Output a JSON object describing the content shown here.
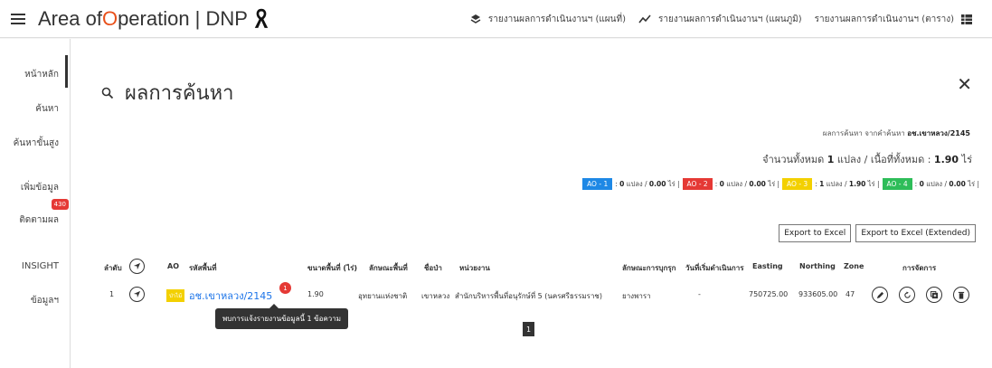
{
  "app": {
    "title_prefix": "Area of ",
    "title_o": "O",
    "title_suffix": "peration | DNP",
    "menu_icon": "hamburger-menu-icon",
    "ribbon_icon": "mourning-ribbon-icon"
  },
  "topnav": [
    {
      "icon": "layers-icon",
      "label": "รายงานผลการดำเนินงานฯ (แผนที่)"
    },
    {
      "icon": "line-chart-icon",
      "label": "รายงานผลการดำเนินงานฯ (แผนภูมิ)"
    },
    {
      "icon": "table-icon",
      "label": "รายงานผลการดำเนินงานฯ (ตาราง)"
    }
  ],
  "sidebar": {
    "items": [
      {
        "label": "หน้าหลัก"
      },
      {
        "label": "ค้นหา"
      },
      {
        "label": "ค้นหาขั้นสูง"
      },
      {
        "label": "เพิ่มข้อมูล"
      },
      {
        "label": "ติดตามผล",
        "badge": "430"
      },
      {
        "label": "INSIGHT"
      },
      {
        "label": "ข้อมูลฯ"
      }
    ]
  },
  "search": {
    "title": "ผลการค้นหา",
    "result_prefix": "ผลการค้นหา จากคำค้นหา ",
    "result_query": "อช.เขาหลวง/2145",
    "total_prefix": "จำนวนทั้งหมด ",
    "total_count": "1",
    "total_mid": " แปลง / เนื้อที่ทั้งหมด : ",
    "total_area": "1.90",
    "total_unit": " ไร่"
  },
  "ao_summary": [
    {
      "tag": "AO - 1",
      "color": "#1e88e5",
      "plots": "0",
      "area": "0.00"
    },
    {
      "tag": "AO - 2",
      "color": "#e53935",
      "plots": "0",
      "area": "0.00"
    },
    {
      "tag": "AO - 3",
      "color": "#f3d000",
      "plots": "1",
      "area": "1.90"
    },
    {
      "tag": "AO - 4",
      "color": "#2ebd59",
      "plots": "0",
      "area": "0.00"
    }
  ],
  "ao_units": {
    "plots": "แปลง",
    "area": "ไร่"
  },
  "export": {
    "excel": "Export to Excel",
    "excel_ext": "Export to Excel (Extended)"
  },
  "table": {
    "headers": {
      "order": "ลำดับ",
      "ao": "AO",
      "code": "รหัสพื้นที่",
      "size": "ขนาดพื้นที่ (ไร่)",
      "type": "ลักษณะพื้นที่",
      "name": "ชื่อป่า",
      "unit": "หน่วยงาน",
      "encroach": "ลักษณะการบุกรุก",
      "start_date": "วันที่เริ่มดำเนินการ",
      "easting": "Easting",
      "northing": "Northing",
      "zone": "Zone",
      "actions": "การจัดการ"
    },
    "rows": [
      {
        "order": "1",
        "ao": "ป่าไม้",
        "ao_color": "#f3d000",
        "code": "อช.เขาหลวง/2145",
        "notif": "1",
        "size": "1.90",
        "type": "อุทยานแห่งชาติ",
        "name": "เขาหลวง",
        "unit": "สำนักบริหารพื้นที่อนุรักษ์ที่ 5 (นครศรีธรรมราช)",
        "encroach": "ยางพารา",
        "start_date": "-",
        "easting": "750725.00",
        "northing": "933605.00",
        "zone": "47"
      }
    ]
  },
  "tooltip": "พบการแจ้งรายงานข้อมูลนี้ 1 ข้อความ",
  "pager": {
    "current": "1"
  }
}
